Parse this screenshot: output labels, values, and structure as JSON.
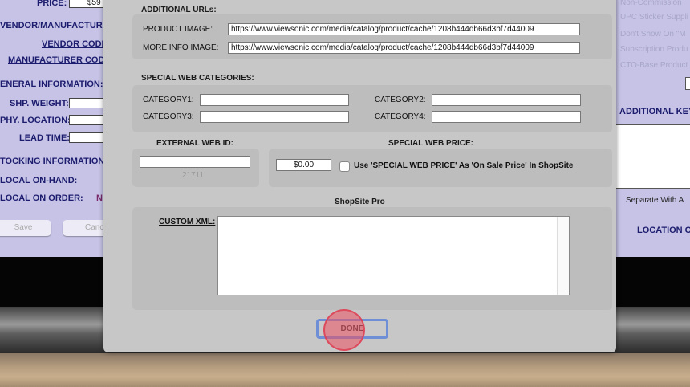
{
  "left_window": {
    "price_label": "PRICE:",
    "price_value": "$59",
    "vendor_heading": "VENDOR/MANUFACTURER",
    "vendor_code": "VENDOR CODE",
    "manufacturer_code": "MANUFACTURER CODE",
    "general_heading": "ENERAL INFORMATION:",
    "shp_weight": "SHP. WEIGHT:",
    "phy_location": "PHY. LOCATION:",
    "lead_time": "LEAD TIME:",
    "stocking_heading": "TOCKING INFORMATION:",
    "local_on_hand": "LOCAL ON-HAND:",
    "local_on_order": "LOCAL ON ORDER:",
    "local_on_order_value": "N",
    "save_label": "Save",
    "cancel_label": "Canc"
  },
  "right_window": {
    "faint_items": [
      "Non-Commission",
      "UPC Sticker Suppli",
      "Don't Show On \"M",
      "Subscription Produ",
      "CTO-Base Product"
    ],
    "additional_keywords": "ADDITIONAL KEY",
    "separate_hint": "Separate With A",
    "location": "LOCATION C"
  },
  "dialog": {
    "additional_urls_heading": "ADDITIONAL URLs:",
    "product_image_label": "PRODUCT IMAGE:",
    "product_image_value": "https://www.viewsonic.com/media/catalog/product/cache/1208b444db66d3bf7d44009",
    "more_info_image_label": "MORE INFO IMAGE:",
    "more_info_image_value": "https://www.viewsonic.com/media/catalog/product/cache/1208b444db66d3bf7d44009",
    "special_web_categories_heading": "SPECIAL WEB CATEGORIES:",
    "category1_label": "CATEGORY1:",
    "category2_label": "CATEGORY2:",
    "category3_label": "CATEGORY3:",
    "category4_label": "CATEGORY4:",
    "external_web_id_heading": "EXTERNAL WEB ID:",
    "external_web_id_placeholder": "21711",
    "special_web_price_heading": "SPECIAL WEB PRICE:",
    "special_web_price_value": "$0.00",
    "use_special_price_label": "Use 'SPECIAL WEB PRICE' As 'On Sale Price' In ShopSite",
    "shopsite_pro_heading": "ShopSite Pro",
    "custom_xml_label": "CUSTOM XML:",
    "done_label": "DONE"
  }
}
